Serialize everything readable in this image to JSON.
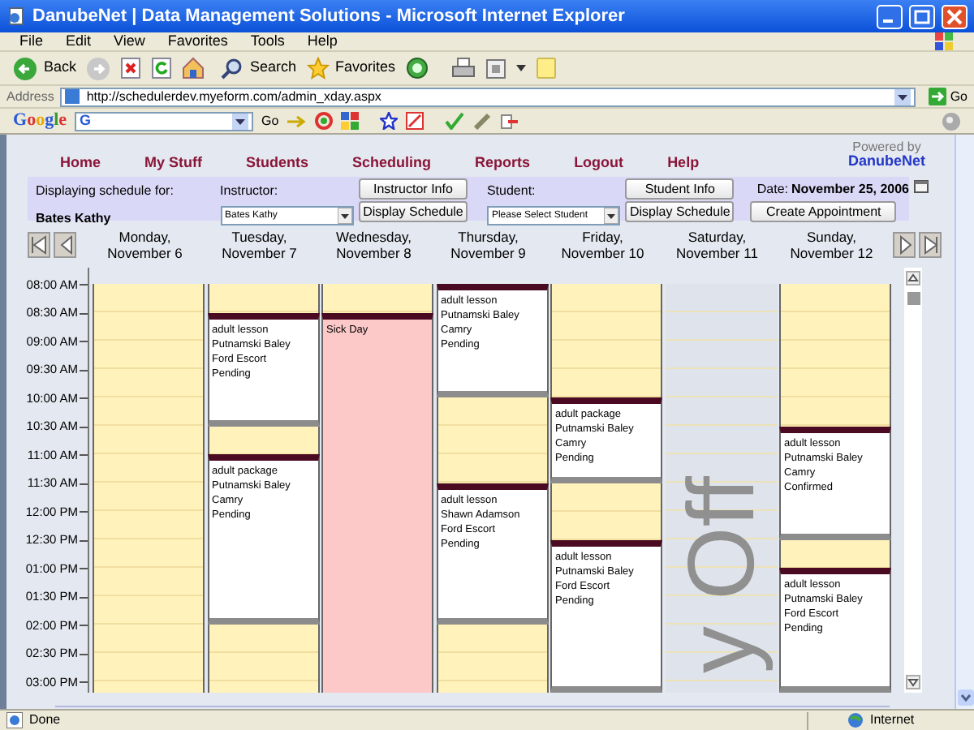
{
  "window": {
    "title": "DanubeNet | Data Management Solutions - Microsoft Internet Explorer"
  },
  "menu": [
    "File",
    "Edit",
    "View",
    "Favorites",
    "Tools",
    "Help"
  ],
  "toolbar": {
    "back": "Back",
    "search": "Search",
    "favorites": "Favorites"
  },
  "address": {
    "label": "Address",
    "value": "http://schedulerdev.myeform.com/admin_xday.aspx",
    "go": "Go"
  },
  "google_toolbar": {
    "logo": "Google",
    "field_letter": "G",
    "go": "Go"
  },
  "nav": [
    "Home",
    "My Stuff",
    "Students",
    "Scheduling",
    "Reports",
    "Logout",
    "Help"
  ],
  "powered_by": {
    "label": "Powered by",
    "brand": "DanubeNet"
  },
  "schedule_form": {
    "displaying_label": "Displaying schedule for:",
    "displaying_name": "Bates Kathy",
    "instructor_label": "Instructor:",
    "instructor_value": "Bates Kathy",
    "instructor_info": "Instructor Info",
    "instructor_display": "Display Schedule",
    "student_label": "Student:",
    "student_value": "Please Select Student",
    "student_info": "Student Info",
    "student_display": "Display Schedule",
    "date_label": "Date:",
    "date_value": "November 25, 2006",
    "create": "Create Appointment"
  },
  "times": [
    "08:00 AM",
    "08:30 AM",
    "09:00 AM",
    "09:30 AM",
    "10:00 AM",
    "10:30 AM",
    "11:00 AM",
    "11:30 AM",
    "12:00 PM",
    "12:30 PM",
    "01:00 PM",
    "01:30 PM",
    "02:00 PM",
    "02:30 PM",
    "03:00 PM"
  ],
  "days": [
    {
      "weekday": "Monday,",
      "date": "November 6",
      "slots": [
        {
          "kind": "free"
        },
        {
          "kind": "free"
        },
        {
          "kind": "free"
        },
        {
          "kind": "free"
        },
        {
          "kind": "free"
        },
        {
          "kind": "free"
        },
        {
          "kind": "free"
        },
        {
          "kind": "free"
        },
        {
          "kind": "free"
        },
        {
          "kind": "free"
        },
        {
          "kind": "free"
        },
        {
          "kind": "free"
        },
        {
          "kind": "free"
        },
        {
          "kind": "free"
        }
      ]
    },
    {
      "weekday": "Tuesday,",
      "date": "November 7",
      "slots": [
        {
          "kind": "free"
        },
        {
          "kind": "booked",
          "lines": [
            "adult lesson",
            "Putnamski Baley",
            "Ford Escort",
            "Pending"
          ]
        },
        {
          "kind": "booked"
        },
        {
          "kind": "booked"
        },
        {
          "kind": "booked"
        },
        {
          "kind": "free"
        },
        {
          "kind": "booked",
          "lines": [
            "adult package",
            "Putnamski Baley",
            "Camry",
            "Pending"
          ]
        },
        {
          "kind": "booked"
        },
        {
          "kind": "booked"
        },
        {
          "kind": "booked"
        },
        {
          "kind": "booked"
        },
        {
          "kind": "booked"
        },
        {
          "kind": "free"
        },
        {
          "kind": "free"
        }
      ]
    },
    {
      "weekday": "Wednesday,",
      "date": "November 8",
      "slots": [
        {
          "kind": "free"
        },
        {
          "kind": "sick",
          "lines": [
            "Sick Day"
          ]
        },
        {
          "kind": "sick"
        },
        {
          "kind": "sick"
        },
        {
          "kind": "sick"
        },
        {
          "kind": "sick"
        },
        {
          "kind": "sick"
        },
        {
          "kind": "sick"
        },
        {
          "kind": "sick"
        },
        {
          "kind": "sick"
        },
        {
          "kind": "sick"
        },
        {
          "kind": "sick"
        },
        {
          "kind": "sick"
        },
        {
          "kind": "sick"
        }
      ]
    },
    {
      "weekday": "Thursday,",
      "date": "November 9",
      "slots": [
        {
          "kind": "booked",
          "lines": [
            "adult lesson",
            "Putnamski Baley",
            "Camry",
            "Pending"
          ]
        },
        {
          "kind": "booked"
        },
        {
          "kind": "booked"
        },
        {
          "kind": "booked"
        },
        {
          "kind": "free"
        },
        {
          "kind": "free"
        },
        {
          "kind": "free"
        },
        {
          "kind": "booked",
          "lines": [
            "adult lesson",
            "Shawn Adamson",
            "Ford Escort",
            "Pending"
          ]
        },
        {
          "kind": "booked"
        },
        {
          "kind": "booked"
        },
        {
          "kind": "booked"
        },
        {
          "kind": "booked"
        },
        {
          "kind": "free"
        },
        {
          "kind": "free"
        }
      ]
    },
    {
      "weekday": "Friday,",
      "date": "November 10",
      "slots": [
        {
          "kind": "free"
        },
        {
          "kind": "free"
        },
        {
          "kind": "free"
        },
        {
          "kind": "free"
        },
        {
          "kind": "booked",
          "lines": [
            "adult package",
            "Putnamski Baley",
            "Camry",
            "Pending"
          ]
        },
        {
          "kind": "booked"
        },
        {
          "kind": "booked"
        },
        {
          "kind": "free"
        },
        {
          "kind": "free"
        },
        {
          "kind": "booked",
          "lines": [
            "adult lesson",
            "Putnamski Baley",
            "Ford Escort",
            "Pending"
          ]
        },
        {
          "kind": "booked"
        },
        {
          "kind": "booked"
        },
        {
          "kind": "booked"
        },
        {
          "kind": "booked"
        }
      ]
    },
    {
      "weekday": "Saturday,",
      "date": "November 11",
      "slots": [
        {
          "kind": "off",
          "lines": [
            "y Off"
          ]
        },
        {
          "kind": "off"
        },
        {
          "kind": "off"
        },
        {
          "kind": "off"
        },
        {
          "kind": "off"
        },
        {
          "kind": "off"
        },
        {
          "kind": "off"
        },
        {
          "kind": "off"
        },
        {
          "kind": "off"
        },
        {
          "kind": "off"
        },
        {
          "kind": "off"
        },
        {
          "kind": "off"
        },
        {
          "kind": "off"
        },
        {
          "kind": "off"
        }
      ]
    },
    {
      "weekday": "Sunday,",
      "date": "November 12",
      "slots": [
        {
          "kind": "free"
        },
        {
          "kind": "free"
        },
        {
          "kind": "free"
        },
        {
          "kind": "free"
        },
        {
          "kind": "free"
        },
        {
          "kind": "booked",
          "lines": [
            "adult lesson",
            "Putnamski Baley",
            "Camry",
            "Confirmed"
          ]
        },
        {
          "kind": "booked"
        },
        {
          "kind": "booked"
        },
        {
          "kind": "booked"
        },
        {
          "kind": "free"
        },
        {
          "kind": "booked",
          "lines": [
            "adult lesson",
            "Putnamski Baley",
            "Ford Escort",
            "Pending"
          ]
        },
        {
          "kind": "booked"
        },
        {
          "kind": "booked"
        },
        {
          "kind": "booked"
        }
      ]
    }
  ],
  "status_bar": {
    "text": "Done",
    "zone": "Internet"
  }
}
